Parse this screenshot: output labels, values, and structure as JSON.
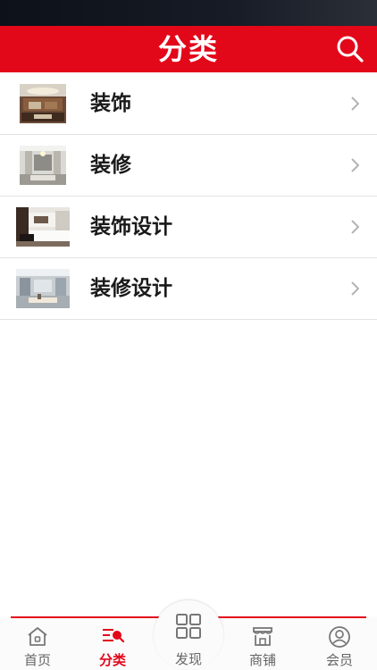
{
  "header": {
    "title": "分类"
  },
  "categories": [
    {
      "label": "装饰"
    },
    {
      "label": "装修"
    },
    {
      "label": "装饰设计"
    },
    {
      "label": "装修设计"
    }
  ],
  "tabbar": {
    "tabs": [
      {
        "label": "首页",
        "icon": "home-icon"
      },
      {
        "label": "分类",
        "icon": "category-icon",
        "active": true
      },
      {
        "label": "发现",
        "icon": "grid-icon"
      },
      {
        "label": "商铺",
        "icon": "shop-icon"
      },
      {
        "label": "会员",
        "icon": "user-icon"
      }
    ]
  },
  "colors": {
    "accent": "#e3071a",
    "status_bar": "#111621",
    "text": "#1a1a1a"
  }
}
